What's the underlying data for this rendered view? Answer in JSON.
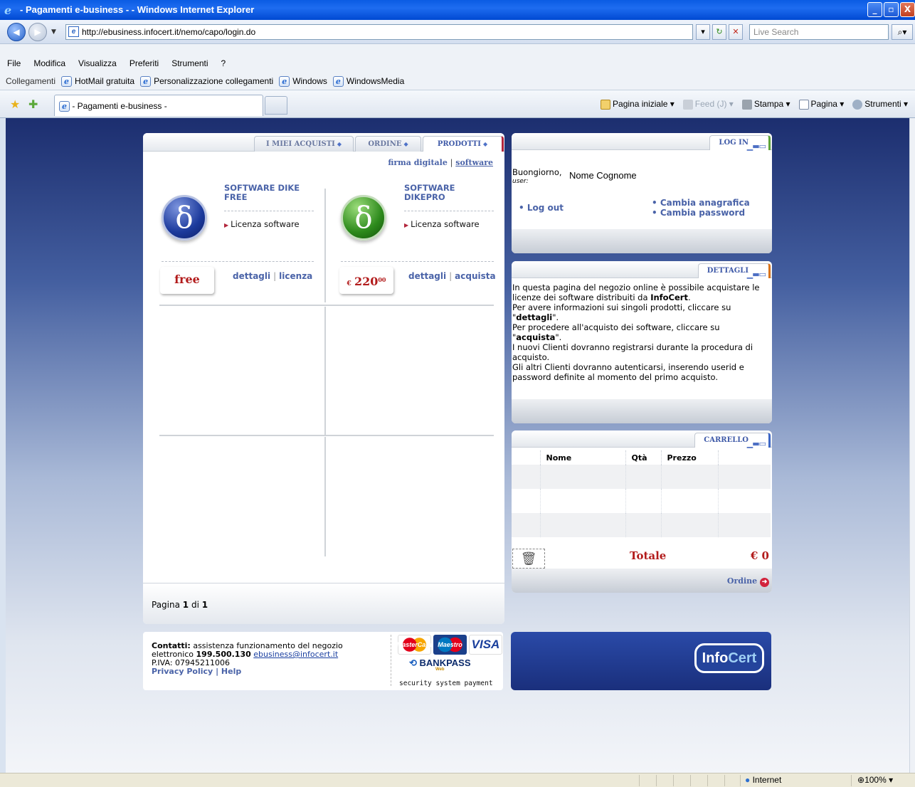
{
  "window": {
    "title": "- Pagamenti e-business - - Windows Internet Explorer",
    "minimize": "_",
    "maximize": "▫",
    "close": "X"
  },
  "address": {
    "url": "http://ebusiness.infocert.it/nemo/capo/login.do",
    "search_placeholder": "Live Search"
  },
  "menu": [
    "File",
    "Modifica",
    "Visualizza",
    "Preferiti",
    "Strumenti",
    "?"
  ],
  "links": {
    "label": "Collegamenti",
    "items": [
      "HotMail gratuita",
      "Personalizzazione collegamenti",
      "Windows",
      "WindowsMedia"
    ]
  },
  "tab": {
    "title": "- Pagamenti e-business -"
  },
  "commands": {
    "home": "Pagina iniziale",
    "feed": "Feed (J)",
    "print": "Stampa",
    "page": "Pagina",
    "tools": "Strumenti"
  },
  "products_panel": {
    "tabs": [
      "I MIEI ACQUISTI",
      "ORDINE",
      "PRODOTTI"
    ],
    "filter_label": "firma digitale",
    "filter_sep": "|",
    "filter_active": "software",
    "items": [
      {
        "title_line1": "SOFTWARE DIKE",
        "title_line2": "FREE",
        "license": "Licenza software",
        "price": "free",
        "link1": "dettagli",
        "link2": "licenza"
      },
      {
        "title_line1": "SOFTWARE",
        "title_line2": "DIKEPRO",
        "license": "Licenza software",
        "price_currency": "€",
        "price_int": "220",
        "price_dec": "00",
        "link1": "dettagli",
        "link2": "acquista"
      }
    ],
    "pagination": {
      "prefix": "Pagina",
      "current": "1",
      "of": "di",
      "total": "1"
    }
  },
  "login_box": {
    "tab": "LOG IN",
    "greeting": "Buongiorno,",
    "user_label": "user:",
    "user_name": "Nome Cognome",
    "logout": "Log out",
    "change_profile": "Cambia anagrafica",
    "change_password": "Cambia password"
  },
  "details_box": {
    "tab": "DETTAGLI",
    "p1a": "In questa pagina del negozio online è possibile acquistare le licenze dei software distribuiti da ",
    "p1b": "InfoCert",
    "p1c": ".",
    "p2a": "Per avere informazioni sui singoli prodotti, cliccare su \"",
    "p2b": "dettagli",
    "p2c": "\".",
    "p3a": "Per procedere all'acquisto dei software, cliccare su \"",
    "p3b": "acquista",
    "p3c": "\".",
    "p4": "I nuovi Clienti dovranno registrarsi durante la procedura di acquisto.",
    "p5": "Gli altri Clienti dovranno autenticarsi, inserendo userid e password definite al momento del primo acquisto."
  },
  "cart_box": {
    "tab": "CARRELLO",
    "col_name": "Nome",
    "col_qty": "Qtà",
    "col_price": "Prezzo",
    "total_label": "Totale",
    "total_value": "€ 0",
    "order_link": "Ordine"
  },
  "footer": {
    "contacts_label": "Contatti:",
    "contacts_text": " assistenza funzionamento del negozio elettronico ",
    "phone": "199.500.130",
    "email": "ebusiness@infocert.it",
    "piva": "P.IVA: 07945211006",
    "privacy": "Privacy Policy",
    "help": "Help",
    "card_mc": "MasterCard",
    "card_maestro": "Maestro",
    "card_visa": "VISA",
    "bankpass": "BANKPASS",
    "bankpass_web": "Web",
    "security": "security system payment",
    "brand_a": "Info",
    "brand_b": "Cert"
  },
  "status": {
    "zone": "Internet",
    "zoom": "100%"
  },
  "colors": {
    "accent_blue": "#4a63a8",
    "price_red": "#b21b1b",
    "bg_navy": "#1c2e6f"
  }
}
